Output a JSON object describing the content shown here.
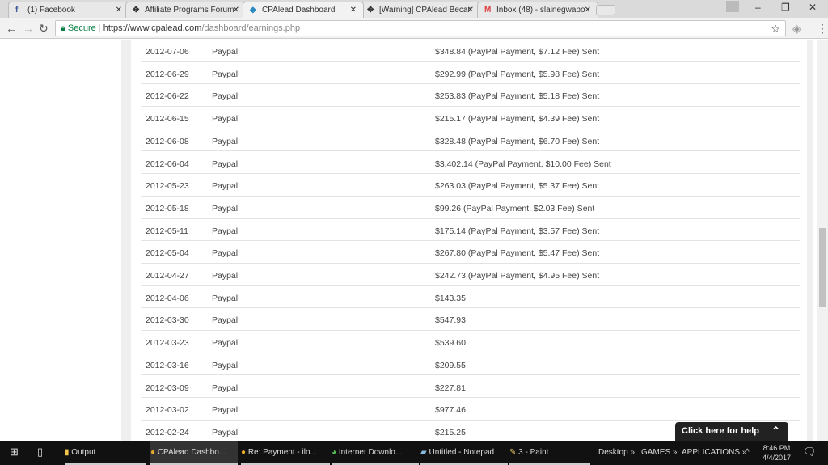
{
  "browser": {
    "tabs": [
      {
        "title": "(1) Facebook",
        "icon": "facebook-icon"
      },
      {
        "title": "Affiliate Programs Forum",
        "icon": "forum-icon"
      },
      {
        "title": "CPAlead Dashboard",
        "icon": "cpalead-icon",
        "active": true
      },
      {
        "title": "[Warning] CPAlead Becar",
        "icon": "forum-icon"
      },
      {
        "title": "Inbox (48) - slainegwapo",
        "icon": "gmail-icon"
      }
    ],
    "secure_label": "Secure",
    "url_host": "https://www.cpalead.com",
    "url_path": "/dashboard/earnings.php"
  },
  "payments": [
    [
      "2012-07-06",
      "Paypal",
      "$348.84 (PayPal Payment, $7.12 Fee) Sent"
    ],
    [
      "2012-06-29",
      "Paypal",
      "$292.99 (PayPal Payment, $5.98 Fee) Sent"
    ],
    [
      "2012-06-22",
      "Paypal",
      "$253.83 (PayPal Payment, $5.18 Fee) Sent"
    ],
    [
      "2012-06-15",
      "Paypal",
      "$215.17 (PayPal Payment, $4.39 Fee) Sent"
    ],
    [
      "2012-06-08",
      "Paypal",
      "$328.48 (PayPal Payment, $6.70 Fee) Sent"
    ],
    [
      "2012-06-04",
      "Paypal",
      "$3,402.14 (PayPal Payment, $10.00 Fee) Sent"
    ],
    [
      "2012-05-23",
      "Paypal",
      "$263.03 (PayPal Payment, $5.37 Fee) Sent"
    ],
    [
      "2012-05-18",
      "Paypal",
      "$99.26 (PayPal Payment, $2.03 Fee) Sent"
    ],
    [
      "2012-05-11",
      "Paypal",
      "$175.14 (PayPal Payment, $3.57 Fee) Sent"
    ],
    [
      "2012-05-04",
      "Paypal",
      "$267.80 (PayPal Payment, $5.47 Fee) Sent"
    ],
    [
      "2012-04-27",
      "Paypal",
      "$242.73 (PayPal Payment, $4.95 Fee) Sent"
    ],
    [
      "2012-04-06",
      "Paypal",
      "$143.35"
    ],
    [
      "2012-03-30",
      "Paypal",
      "$547.93"
    ],
    [
      "2012-03-23",
      "Paypal",
      "$539.60"
    ],
    [
      "2012-03-16",
      "Paypal",
      "$209.55"
    ],
    [
      "2012-03-09",
      "Paypal",
      "$227.81"
    ],
    [
      "2012-03-02",
      "Paypal",
      "$977.46"
    ],
    [
      "2012-02-24",
      "Paypal",
      "$215.25"
    ]
  ],
  "help_label": "Click here for help",
  "taskbar": {
    "items": [
      "Output",
      "CPAlead Dashbo...",
      "Re: Payment - ilo...",
      "Internet Downlo...",
      "Untitled - Notepad",
      "3 - Paint"
    ],
    "toolbars": [
      "Desktop",
      "GAMES",
      "APPLICATIONS"
    ],
    "time": "8:46 PM",
    "date": "4/4/2017"
  }
}
